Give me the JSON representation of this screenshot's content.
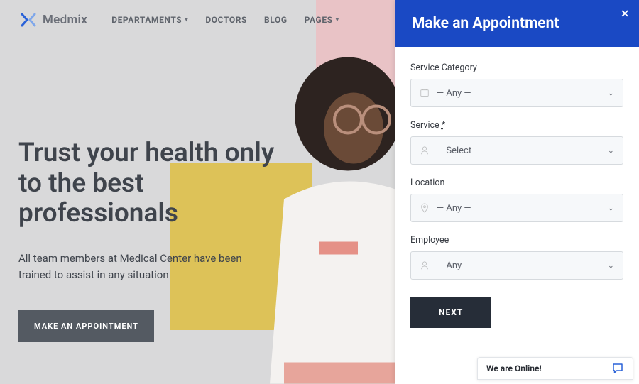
{
  "brand": {
    "name": "Medmix"
  },
  "nav": {
    "items": [
      {
        "label": "DEPARTAMENTS",
        "has_caret": true
      },
      {
        "label": "DOCTORS",
        "has_caret": false
      },
      {
        "label": "BLOG",
        "has_caret": false
      },
      {
        "label": "PAGES",
        "has_caret": true
      }
    ]
  },
  "hero": {
    "headline": "Trust your health only to the best professionals",
    "subhead": "All team members at Medical Center have been trained to assist in any situation",
    "cta_label": "MAKE AN APPOINTMENT"
  },
  "panel": {
    "title": "Make an Appointment",
    "fields": {
      "service_category": {
        "label": "Service Category",
        "value": "— Any —"
      },
      "service": {
        "label": "Service",
        "required_mark": "*",
        "value": "— Select —"
      },
      "location": {
        "label": "Location",
        "value": "— Any —"
      },
      "employee": {
        "label": "Employee",
        "value": "— Any —"
      }
    },
    "next_label": "NEXT"
  },
  "chat": {
    "status": "We are Online!"
  },
  "colors": {
    "primary_blue": "#1a49c4",
    "dark_button": "#262d38",
    "cta_gray": "#545a62",
    "accent_pink": "#e9c3c6",
    "accent_yellow": "#ddc258"
  }
}
